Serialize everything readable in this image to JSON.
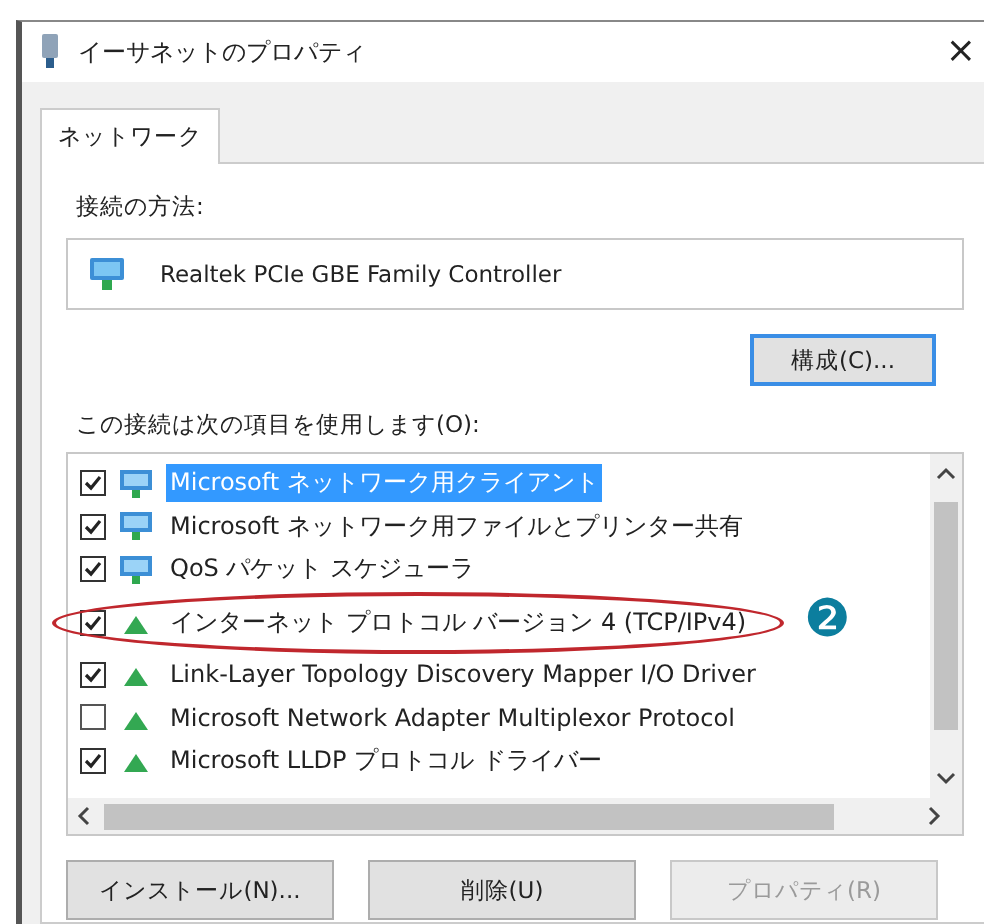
{
  "window": {
    "title": "イーサネットのプロパティ",
    "close": "×"
  },
  "tabs": [
    {
      "label": "ネットワーク",
      "selected": true
    }
  ],
  "connect_using": {
    "label": "接続の方法:",
    "adapter": "Realtek PCIe GBE Family Controller"
  },
  "configure_button": "構成(C)...",
  "items_label": "この接続は次の項目を使用します(O):",
  "items": [
    {
      "kind": "client",
      "label": "Microsoft ネットワーク用クライアント",
      "checked": true,
      "selected": true
    },
    {
      "kind": "client",
      "label": "Microsoft ネットワーク用ファイルとプリンター共有",
      "checked": true,
      "selected": false
    },
    {
      "kind": "client",
      "label": "QoS パケット スケジューラ",
      "checked": true,
      "selected": false
    },
    {
      "kind": "protocol",
      "label": "インターネット プロトコル バージョン 4 (TCP/IPv4)",
      "checked": true,
      "selected": false
    },
    {
      "kind": "protocol",
      "label": "Link-Layer Topology Discovery Mapper I/O Driver",
      "checked": true,
      "selected": false
    },
    {
      "kind": "protocol",
      "label": "Microsoft Network Adapter Multiplexor Protocol",
      "checked": false,
      "selected": false
    },
    {
      "kind": "protocol",
      "label": "Microsoft LLDP プロトコル ドライバー",
      "checked": true,
      "selected": false
    }
  ],
  "buttons": [
    {
      "label": "インストール(N)...",
      "disabled": false
    },
    {
      "label": "削除(U)",
      "disabled": false
    },
    {
      "label": "プロパティ(R)",
      "disabled": true
    }
  ],
  "annotation": {
    "badge": "❷"
  }
}
